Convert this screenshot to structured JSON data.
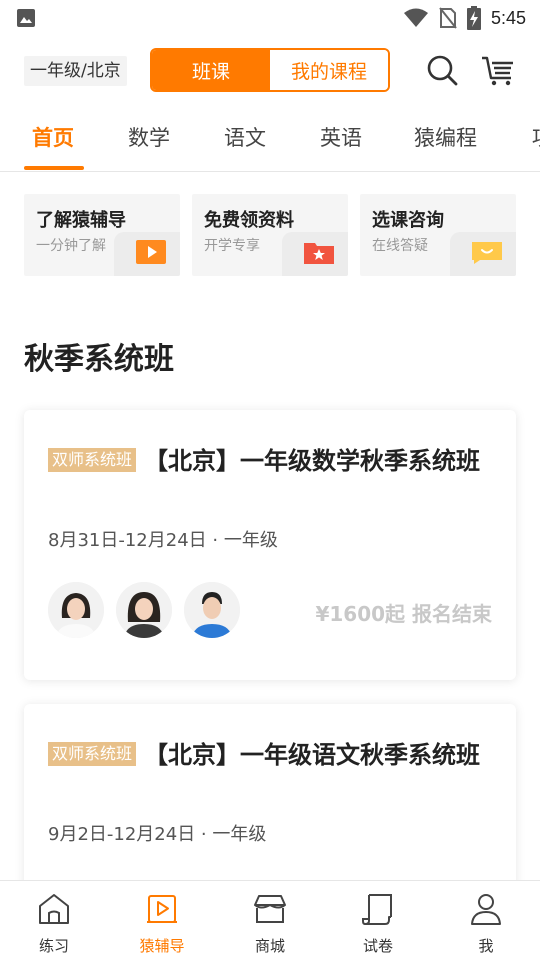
{
  "status_bar": {
    "time": "5:45"
  },
  "header": {
    "grade_location": "一年级/北京",
    "toggle": {
      "active": "班课",
      "inactive": "我的课程"
    }
  },
  "tabs": [
    "首页",
    "数学",
    "语文",
    "英语",
    "猿编程",
    "项"
  ],
  "quick_cards": [
    {
      "title": "了解猿辅导",
      "subtitle": "一分钟了解",
      "icon": "play-icon",
      "color": "#ff8a1f"
    },
    {
      "title": "免费领资料",
      "subtitle": "开学专享",
      "icon": "folder-star-icon",
      "color": "#f1543f"
    },
    {
      "title": "选课咨询",
      "subtitle": "在线答疑",
      "icon": "chat-smile-icon",
      "color": "#ffc94a"
    }
  ],
  "section_title": "秋季系统班",
  "courses": [
    {
      "badge": "双师系统班",
      "title": "【北京】一年级数学秋季系统班",
      "dates": "8月31日-12月24日 · 一年级",
      "price": "¥1600起 报名结束"
    },
    {
      "badge": "双师系统班",
      "title": "【北京】一年级语文秋季系统班",
      "dates": "9月2日-12月24日 · 一年级",
      "price": ""
    }
  ],
  "bottom_nav": [
    {
      "label": "练习",
      "icon": "home-icon"
    },
    {
      "label": "猿辅导",
      "icon": "play-icon",
      "active": true
    },
    {
      "label": "商城",
      "icon": "store-icon"
    },
    {
      "label": "试卷",
      "icon": "paper-scroll-icon"
    },
    {
      "label": "我",
      "icon": "user-icon"
    }
  ],
  "colors": {
    "accent": "#ff7a00",
    "badge": "#e8c089",
    "muted": "#c8c8c8"
  }
}
